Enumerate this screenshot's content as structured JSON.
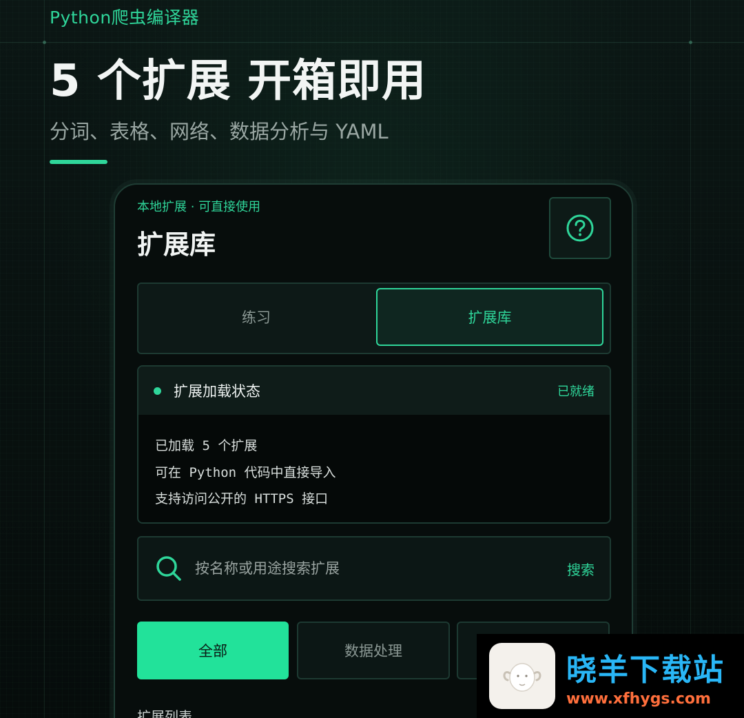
{
  "brand": {
    "name": "Python爬虫编译器"
  },
  "hero": {
    "title": "5 个扩展 开箱即用",
    "subtitle": "分词、表格、网络、数据分析与 YAML"
  },
  "panel": {
    "eyebrow": "本地扩展 · 可直接使用",
    "title": "扩展库",
    "help_icon": "question-circle-icon"
  },
  "tabs": [
    {
      "label": "练习",
      "active": false
    },
    {
      "label": "扩展库",
      "active": true
    }
  ],
  "status": {
    "title": "扩展加载状态",
    "state": "已就绪",
    "lines": [
      "已加载 5 个扩展",
      "可在 Python 代码中直接导入",
      "支持访问公开的 HTTPS 接口"
    ]
  },
  "search": {
    "placeholder": "按名称或用途搜索扩展",
    "button_label": "搜索",
    "icon": "search-icon"
  },
  "filters": [
    {
      "label": "全部",
      "active": true
    },
    {
      "label": "数据处理",
      "active": false
    },
    {
      "label": "",
      "active": false
    }
  ],
  "section": {
    "label": "扩展列表"
  },
  "watermark": {
    "name": "晓羊下载站",
    "url": "www.xfhygs.com"
  },
  "colors": {
    "accent": "#2fd69a",
    "accent_fill": "#22e29a",
    "background": "#07100f",
    "panel_border": "#1d3a32"
  }
}
